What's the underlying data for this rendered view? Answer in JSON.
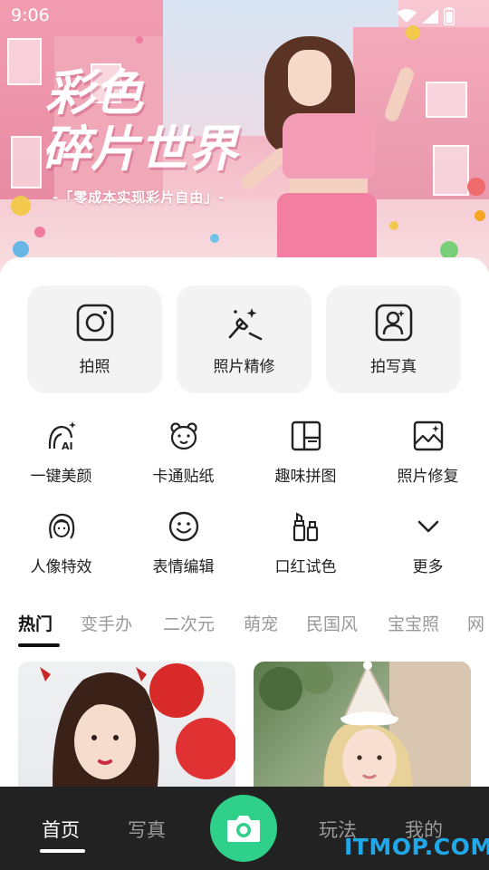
{
  "status_bar": {
    "time": "9:06",
    "icons": [
      "wifi-icon",
      "signal-icon",
      "battery-icon"
    ]
  },
  "hero": {
    "title_line1": "彩色",
    "title_line2": "碎片世界",
    "subtitle": "-「零成本实现彩片自由」-"
  },
  "primary_actions": [
    {
      "label": "拍照",
      "icon": "camera-icon"
    },
    {
      "label": "照片精修",
      "icon": "magic-wand-icon"
    },
    {
      "label": "拍写真",
      "icon": "portrait-icon"
    }
  ],
  "tools": [
    {
      "label": "一键美颜",
      "icon": "ai-beauty-icon"
    },
    {
      "label": "卡通贴纸",
      "icon": "bear-icon"
    },
    {
      "label": "趣味拼图",
      "icon": "collage-icon"
    },
    {
      "label": "照片修复",
      "icon": "photo-restore-icon"
    },
    {
      "label": "人像特效",
      "icon": "face-effect-icon"
    },
    {
      "label": "表情编辑",
      "icon": "smile-icon"
    },
    {
      "label": "口红试色",
      "icon": "lipstick-icon"
    },
    {
      "label": "更多",
      "icon": "chevron-down-icon"
    }
  ],
  "category_tabs": [
    "热门",
    "变手办",
    "二次元",
    "萌宠",
    "民国风",
    "宝宝照",
    "网"
  ],
  "active_tab": "热门",
  "bottom_nav": [
    {
      "label": "首页",
      "active": true
    },
    {
      "label": "写真",
      "active": false
    },
    {
      "label": "玩法",
      "active": false
    },
    {
      "label": "我的",
      "active": false
    }
  ],
  "camera_button_icon": "camera-icon",
  "watermark": "ITMOP.COM",
  "colors": {
    "accent_green": "#2ed08a",
    "nav_bg": "#222222",
    "tile_bg": "#f3f3f3",
    "watermark": "#21a8e8"
  }
}
